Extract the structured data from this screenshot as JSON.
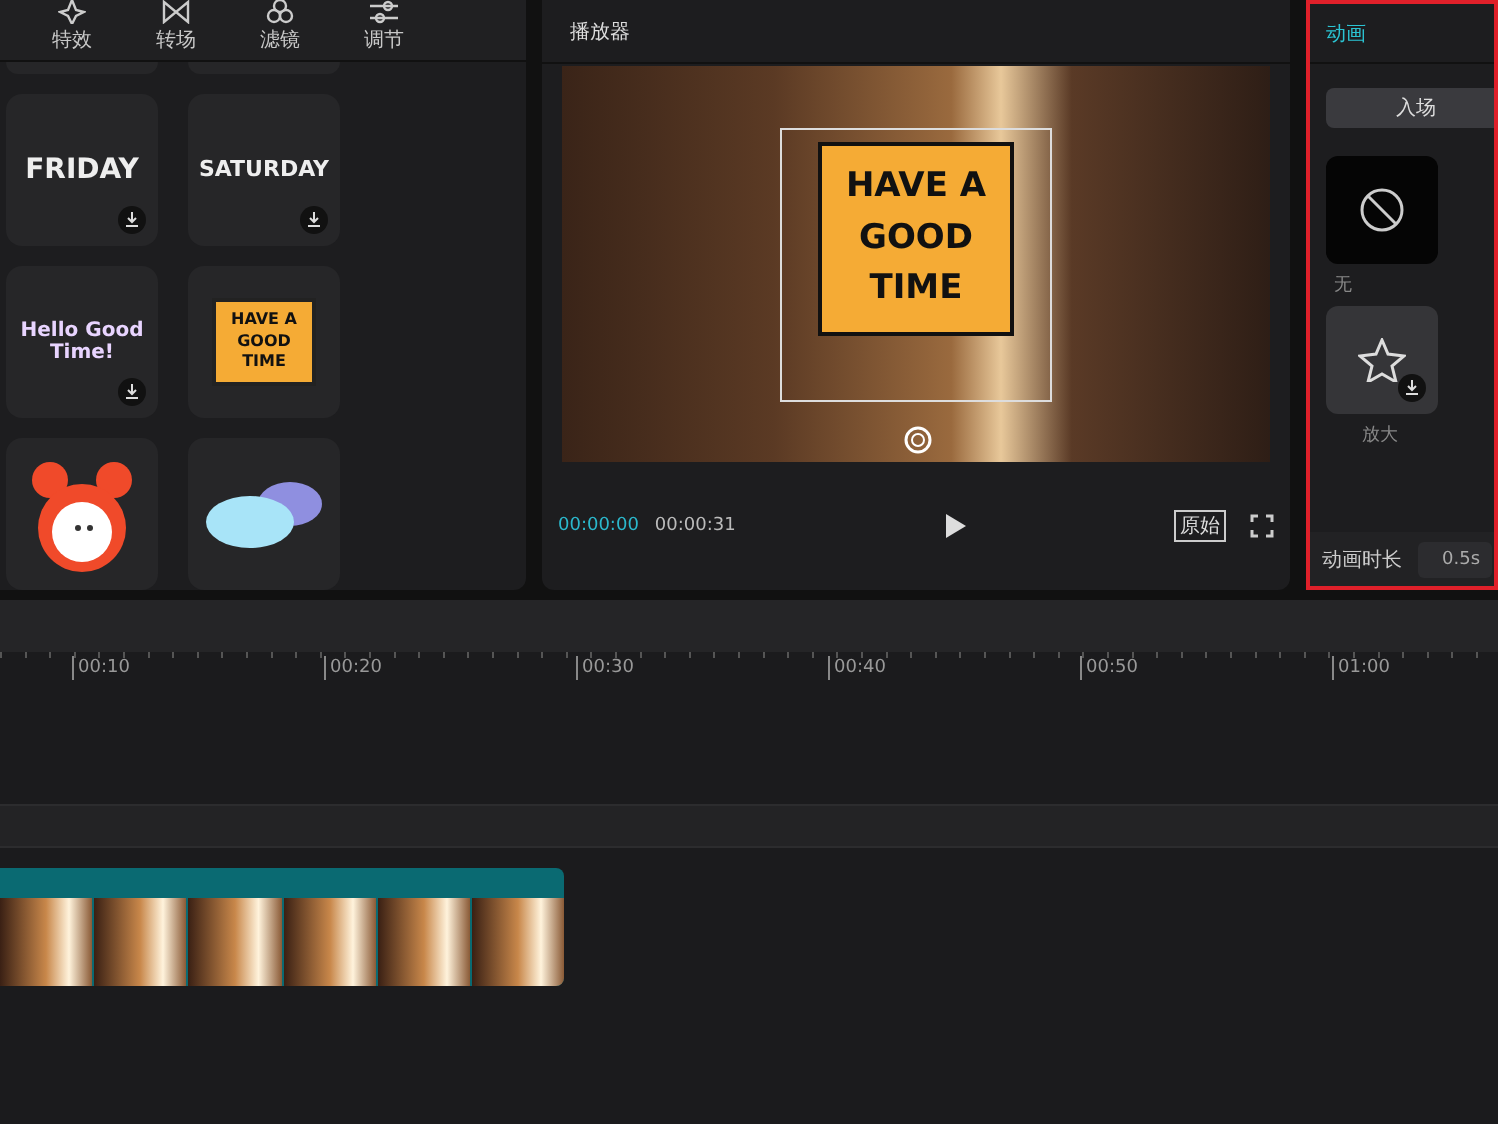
{
  "toolbar": {
    "tabs": [
      {
        "label": "特效",
        "selected": false
      },
      {
        "label": "转场",
        "selected": false
      },
      {
        "label": "滤镜",
        "selected": false
      },
      {
        "label": "调节",
        "selected": false
      }
    ]
  },
  "stickers": [
    {
      "kind": "text",
      "text": "FRIDAY",
      "downloaded": false
    },
    {
      "kind": "text",
      "text": "SATURDAY",
      "downloaded": false
    },
    {
      "kind": "script",
      "text": "Hello Good Time!",
      "downloaded": false
    },
    {
      "kind": "card",
      "text": "HAVE A GOOD TIME",
      "downloaded": true
    },
    {
      "kind": "clock",
      "downloaded": true
    },
    {
      "kind": "cloud",
      "downloaded": true
    }
  ],
  "player": {
    "title": "播放器",
    "overlay_text": "HAVE A GOOD TIME",
    "current_time": "00:00:00",
    "total_time": "00:00:31",
    "ratio_button": "原始"
  },
  "animation": {
    "title": "动画",
    "tabs": [
      {
        "label": "入场",
        "selected": true
      }
    ],
    "items": [
      {
        "label": "无",
        "selected": true,
        "downloaded": true
      },
      {
        "label": "放大",
        "selected": false,
        "downloaded": false
      }
    ],
    "duration_label": "动画时长",
    "duration_value": "0.5s"
  },
  "timeline": {
    "ticks": [
      "00:10",
      "00:20",
      "00:30",
      "00:40",
      "00:50",
      "01:00"
    ]
  }
}
